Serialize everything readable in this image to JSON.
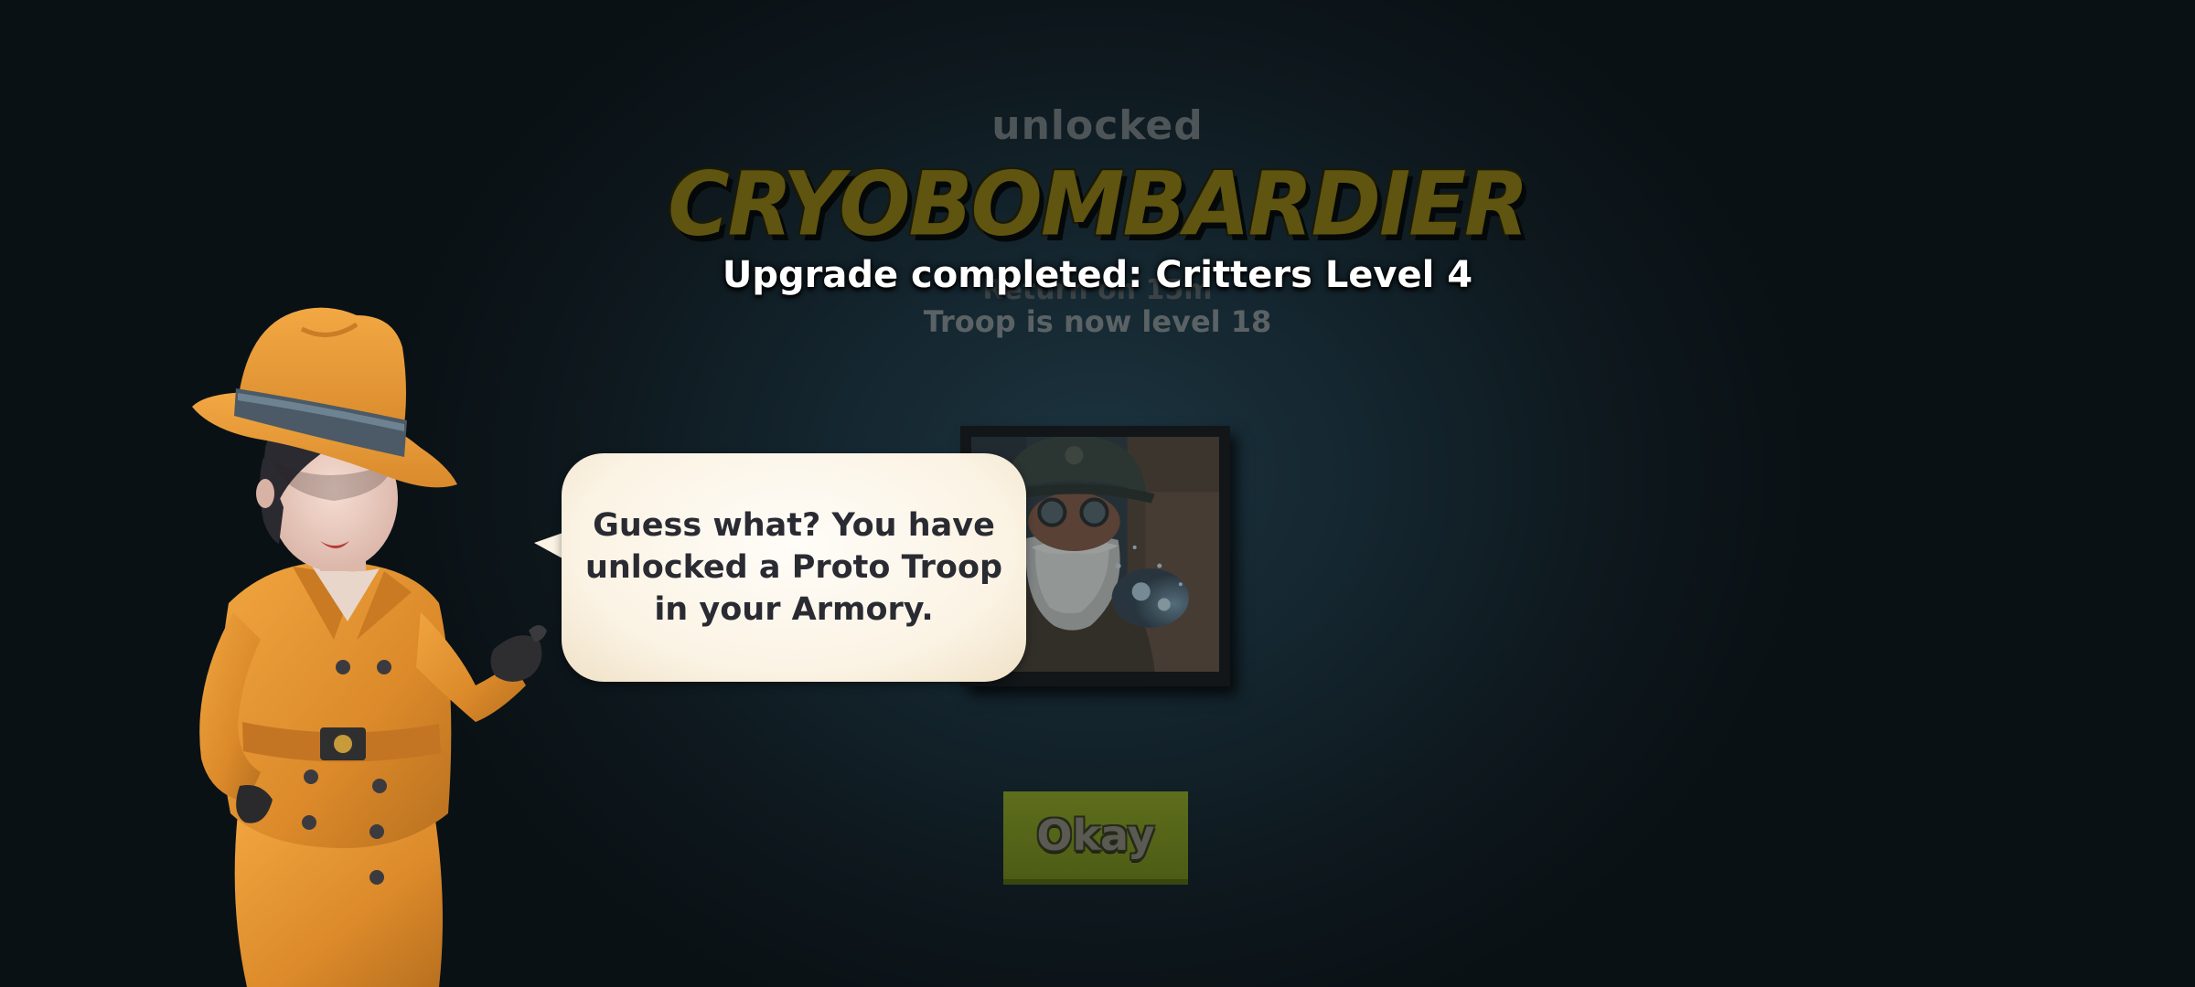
{
  "reward_panel": {
    "unlocked_label": "unlocked",
    "troop_name": "CRYOBOMBARDIER",
    "return_time": "Return on 15m",
    "troop_level": "Troop is now level 18"
  },
  "notification": {
    "upgrade_text": "Upgrade completed: Critters Level 4"
  },
  "dialog": {
    "speech_text": "Guess what? You have unlocked a Proto Troop in your Armory."
  },
  "buttons": {
    "okay_label": "Okay"
  },
  "colors": {
    "background": "#14252e",
    "troop_name": "#5f5410",
    "button_green": "#5d6e1c",
    "bubble": "#fbf3e4",
    "coat_orange": "#e0902f"
  },
  "icons": {
    "character": "detective-advisor",
    "troop_portrait": "cryobombardier-portrait"
  }
}
